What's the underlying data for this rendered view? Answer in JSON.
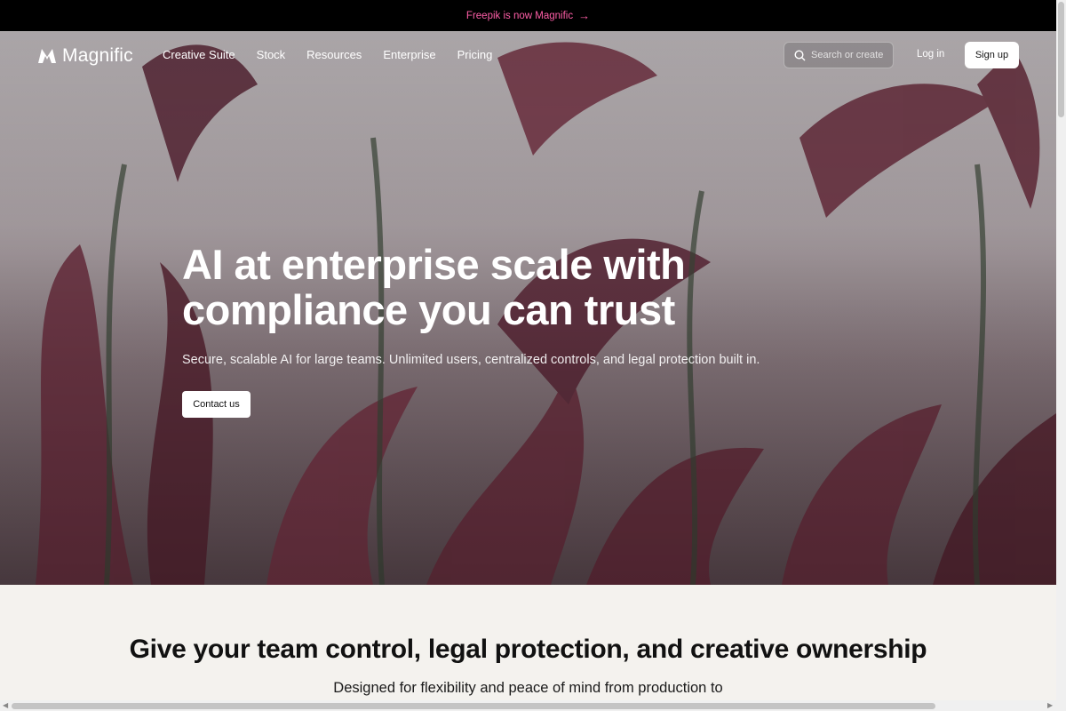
{
  "announcement": {
    "text": "Freepik is now Magnific",
    "arrow": "→"
  },
  "nav": {
    "brand": "Magnific",
    "items": [
      "Creative Suite",
      "Stock",
      "Resources",
      "Enterprise",
      "Pricing"
    ],
    "search_placeholder": "Search or create",
    "login": "Log in",
    "signup": "Sign up"
  },
  "hero": {
    "headline": "AI at enterprise scale with compliance you can trust",
    "subtitle": "Secure, scalable AI for large teams. Unlimited users, centralized controls, and legal protection built in.",
    "cta": "Contact us"
  },
  "section": {
    "title": "Give your team control, legal protection, and creative ownership",
    "subtitle": "Designed for flexibility and peace of mind from production to"
  },
  "colors": {
    "announcement_text": "#ff5fa8",
    "bar_bg": "#000000",
    "page_bg": "#f4f2ee"
  },
  "icons": [
    "magnific-logo-icon",
    "search-icon",
    "arrow-right-icon"
  ]
}
